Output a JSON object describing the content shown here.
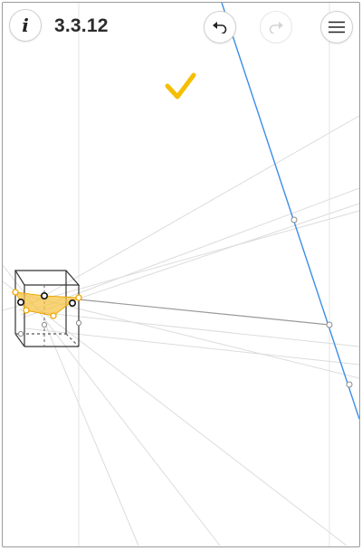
{
  "level": {
    "label": "3.3.12"
  },
  "toolbar": {
    "info_icon_glyph": "i",
    "info_icon": "info-icon",
    "undo_icon": "undo-icon",
    "redo_icon": "redo-icon",
    "redo_enabled": false,
    "menu_icon": "hamburger-menu-icon"
  },
  "status": {
    "solved": true,
    "icon": "checkmark-icon",
    "color": "#f5be00"
  },
  "colors": {
    "construction_line": "#d9d9d9",
    "vertical_guide": "#e4e4e4",
    "highlight_line": "#3c8ee8",
    "solid_line": "#9a9a9a",
    "prism_edge": "#333333",
    "selection_fill": "#f7c548",
    "selection_stroke": "#f0a800"
  }
}
